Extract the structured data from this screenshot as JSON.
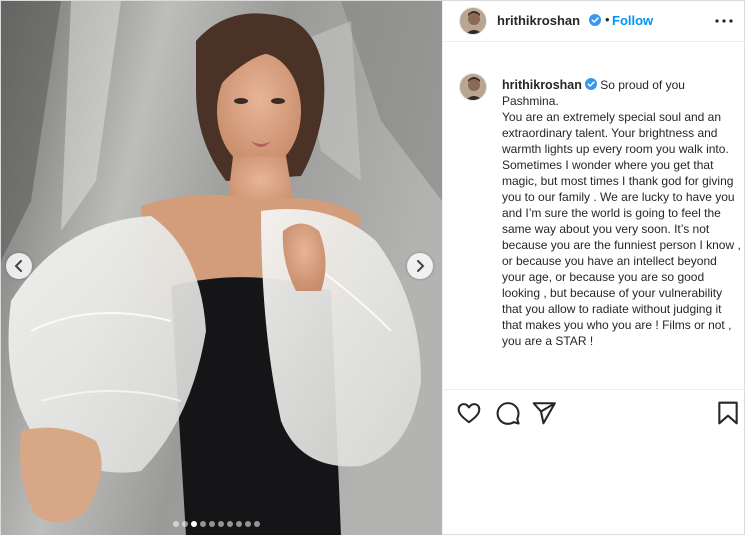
{
  "post": {
    "username": "hrithikroshan",
    "verified": true,
    "separator": "•",
    "follow_label": "Follow",
    "caption_username": "hrithikroshan",
    "caption_text": " So proud of you Pashmina.\nYou are an extremely special soul and an extraordinary talent. Your brightness and warmth lights up every room you walk into. Sometimes I wonder where you get that magic, but most times I thank god for giving you to our family . We are lucky to have you and I’m sure the world is going to feel the same way about you very soon. It’s not because you are the funniest person I know , or because you have an intellect beyond your age, or because you are so good looking , but because of your vulnerability that you allow to radiate without judging it that makes you who you are ! Films or not , you are a STAR !"
  },
  "carousel": {
    "total_slides": 10,
    "active_slide": 3
  },
  "icons": {
    "more": "more-options-icon",
    "like": "heart-icon",
    "comment": "comment-icon",
    "share": "paper-plane-icon",
    "save": "bookmark-icon",
    "prev": "chevron-left-icon",
    "next": "chevron-right-icon",
    "verified": "verified-badge-icon"
  },
  "colors": {
    "follow": "#0095f6",
    "verified": "#3897f0",
    "text": "#262626"
  }
}
